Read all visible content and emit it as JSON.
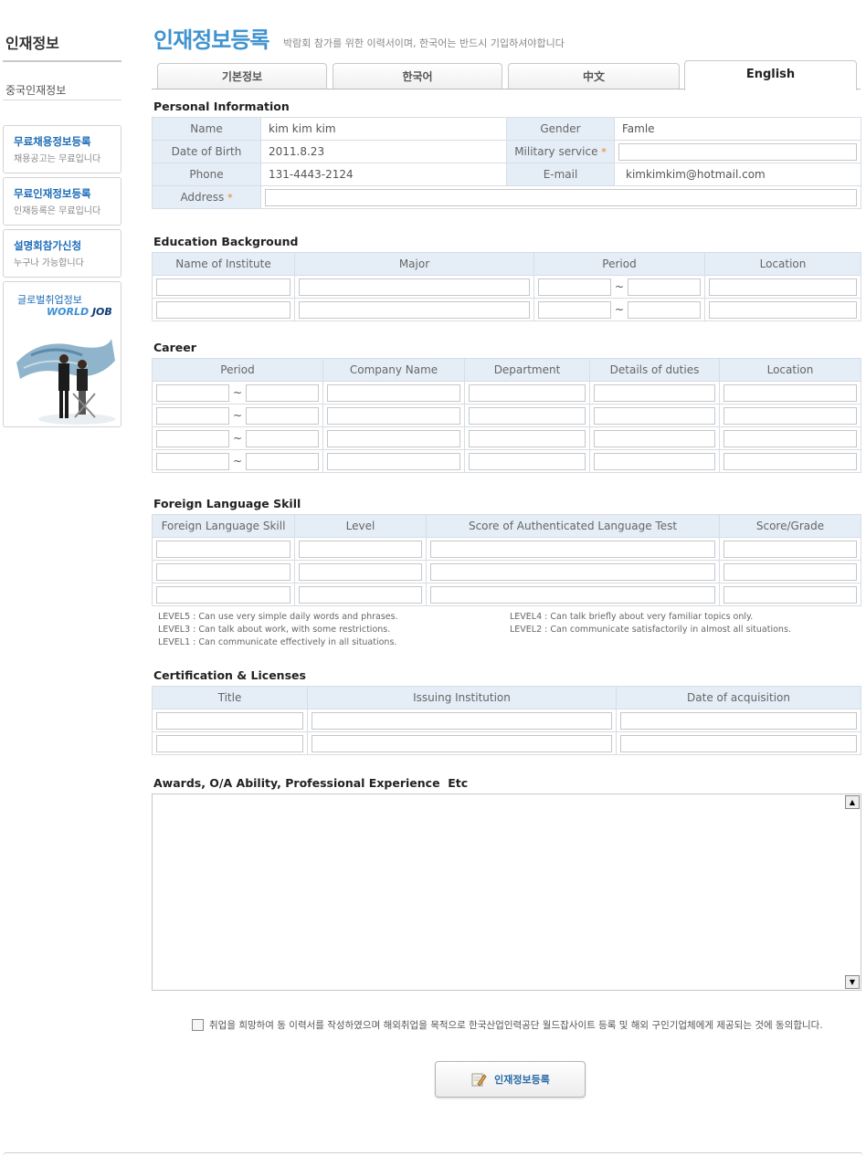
{
  "sidebar": {
    "title": "인재정보",
    "subtitle": "중국인재정보",
    "boxes": [
      {
        "title": "무료채용정보등록",
        "desc": "채용공고는 무료입니다"
      },
      {
        "title": "무료인재정보등록",
        "desc": "인재등록은 무료입니다"
      },
      {
        "title": "설명회참가신청",
        "desc": "누구나 가능합니다"
      }
    ],
    "banner": {
      "title": "글로벌취업정보",
      "logo_a": "WORLD ",
      "logo_b": "JOB"
    }
  },
  "header": {
    "title": "인재정보등록",
    "desc": "박람회 참가를 위한 이력서이며, 한국어는 반드시 기입하셔야합니다"
  },
  "tabs": [
    "기본정보",
    "한국어",
    "中文",
    "English"
  ],
  "personal": {
    "title": "Personal Information",
    "name_label": "Name",
    "name_value": "kim kim kim",
    "gender_label": "Gender",
    "gender_value": "Famle",
    "dob_label": "Date of Birth",
    "dob_value": "2011.8.23",
    "military_label": "Military service",
    "phone_label": "Phone",
    "phone_value": "131-4443-2124",
    "email_label": "E-mail",
    "email_value": "kimkimkim@hotmail.com",
    "address_label": "Address",
    "required_mark": "*"
  },
  "education": {
    "title": "Education Background",
    "columns": [
      "Name of Institute",
      "Major",
      "Period",
      "Location"
    ],
    "dash": "~"
  },
  "career": {
    "title": "Career",
    "columns": [
      "Period",
      "Company Name",
      "Department",
      "Details of duties",
      "Location"
    ]
  },
  "language": {
    "title": "Foreign Language Skill",
    "columns": [
      "Foreign Language Skill",
      "Level",
      "Score of Authenticated Language Test",
      "Score/Grade"
    ],
    "notes": [
      "LEVEL5 : Can use very simple daily words and phrases.",
      "LEVEL4 : Can talk briefly about very familiar topics only.",
      "LEVEL3 : Can talk about work, with some restrictions.",
      "LEVEL2 : Can communicate satisfactorily in almost all situations.",
      "LEVEL1 : Can communicate effectively in all situations."
    ]
  },
  "certs": {
    "title": "Certification & Licenses",
    "columns": [
      "Title",
      "Issuing Institution",
      "Date of acquisition"
    ]
  },
  "awards": {
    "title": "Awards, O/A Ability, Professional Experience  Etc"
  },
  "agree_text": "취업을 희망하여 동 이력서를 작성하였으며 해외취업을 목적으로 한국산업인력공단 월드잡사이트 등록 및 해외 구인기업체에게 제공되는 것에 동의합니다.",
  "submit_label": "인재정보등록",
  "colors": {
    "accent": "#3f93d0",
    "header_bg": "#e5eef6",
    "required": "#e87d1f"
  }
}
